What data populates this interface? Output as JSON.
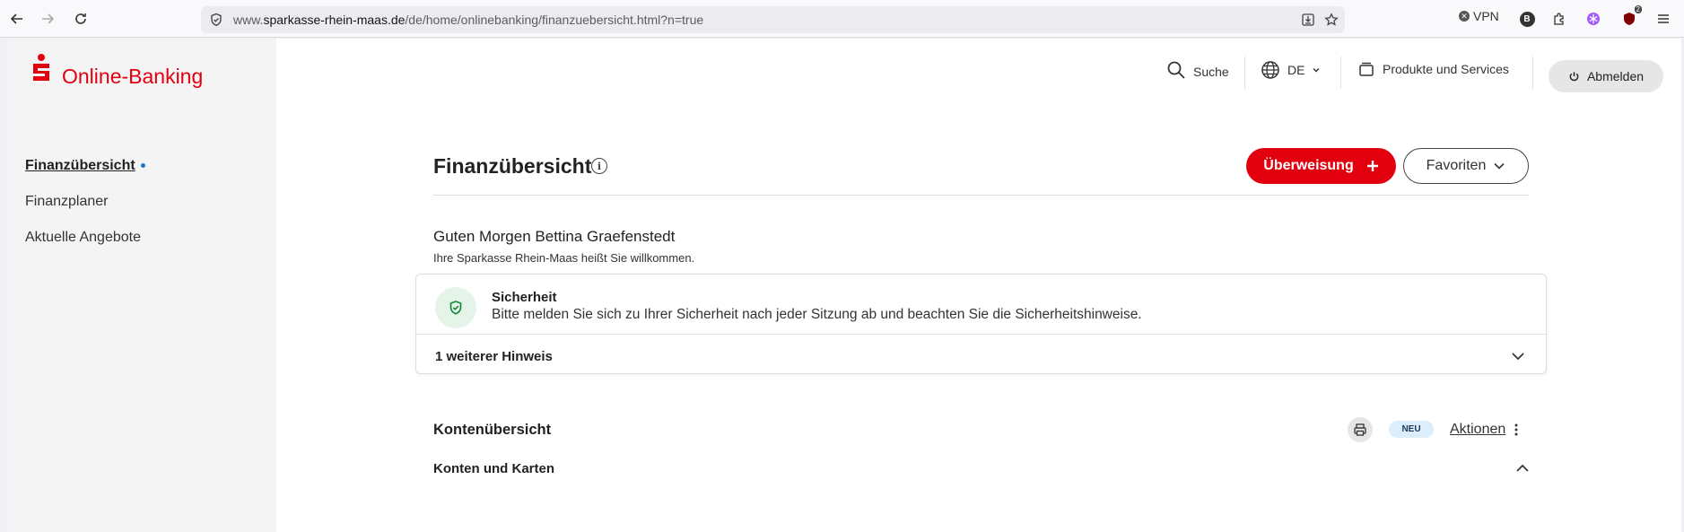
{
  "browser": {
    "url_prefix": "www.",
    "url_host": "sparkasse-rhein-maas.de",
    "url_path": "/de/home/onlinebanking/finanzuebersicht.html?n=true",
    "vpn_label": "VPN",
    "extension_badge": "2",
    "profile_letter": "B"
  },
  "header": {
    "logo_text": "Online-Banking",
    "search_label": "Suche",
    "language_label": "DE",
    "products_label": "Produkte und Services",
    "logout_label": "Abmelden"
  },
  "sidebar": {
    "items": [
      {
        "label": "Finanzübersicht",
        "active": true
      },
      {
        "label": "Finanzplaner",
        "active": false
      },
      {
        "label": "Aktuelle Angebote",
        "active": false
      }
    ]
  },
  "main": {
    "title": "Finanzübersicht",
    "transfer_button": "Überweisung",
    "favorites_button": "Favoriten",
    "greeting": "Guten Morgen Bettina Graefenstedt",
    "greeting_sub": "Ihre Sparkasse Rhein-Maas heißt Sie willkommen.",
    "security_card": {
      "title": "Sicherheit",
      "text": "Bitte melden Sie sich zu Ihrer Sicherheit nach jeder Sitzung ab und beachten Sie die Sicherheitshinweise.",
      "more_label": "1 weiterer Hinweis"
    },
    "accounts": {
      "title": "Kontenübersicht",
      "badge": "NEU",
      "actions_label": "Aktionen",
      "section_label": "Konten und Karten"
    }
  },
  "colors": {
    "brand_red": "#e2000f",
    "active_dot": "#1976d2",
    "security_green": "#1b8a3a"
  }
}
